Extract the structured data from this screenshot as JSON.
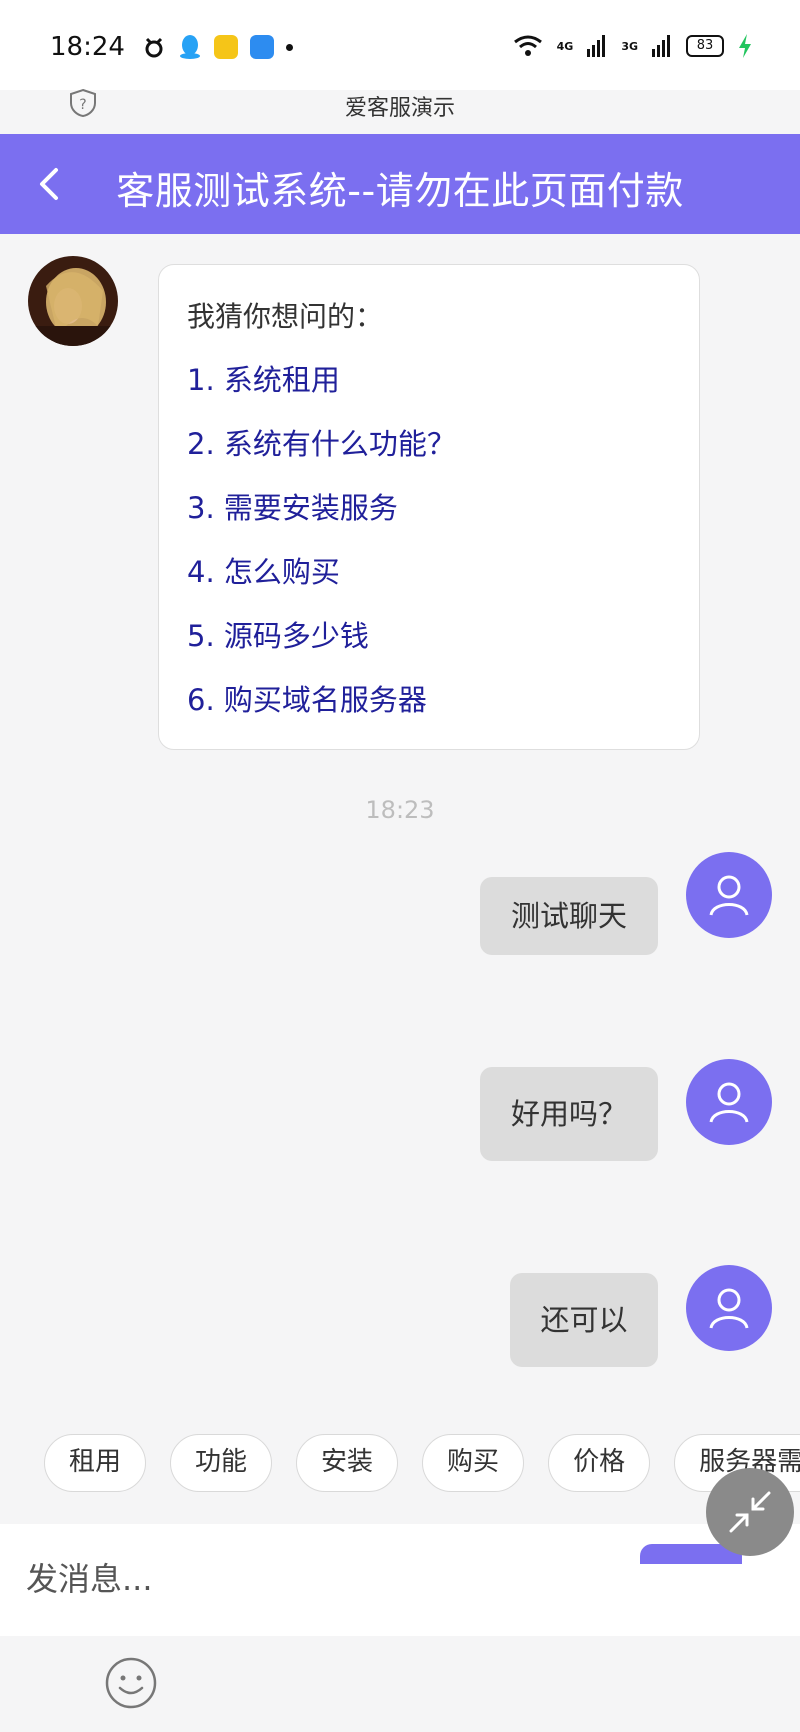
{
  "status_bar": {
    "time": "18:24",
    "network_1": "4G",
    "network_2": "3G",
    "battery": "83"
  },
  "app": {
    "name": "爱客服演示"
  },
  "header": {
    "title": "客服测试系统--请勿在此页面付款"
  },
  "bot_message": {
    "intro": "我猜你想问的：",
    "suggestions": [
      "1.  系统租用",
      "2.  系统有什么功能？",
      "3.  需要安装服务",
      "4.  怎么购买",
      "5.  源码多少钱",
      "6.  购买域名服务器"
    ]
  },
  "timestamp": "18:23",
  "user_messages": [
    "测试聊天",
    "好用吗？",
    "还可以"
  ],
  "quick_replies": [
    "租用",
    "功能",
    "安装",
    "购买",
    "价格",
    "服务器需"
  ],
  "input": {
    "placeholder": "发消息..."
  },
  "colors": {
    "accent": "#7b6ff0",
    "link": "#20209a",
    "user_bubble": "#dcdcdc"
  }
}
